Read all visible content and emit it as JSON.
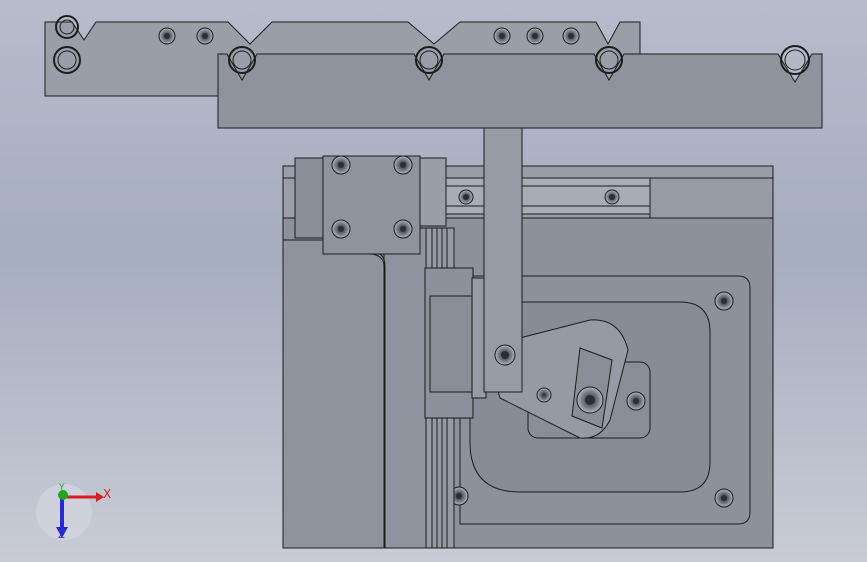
{
  "view": {
    "background_top": "#b7bccc",
    "background_bottom": "#c9ccd6",
    "part_fill": "#8f939e",
    "part_fill_dark": "#767a85",
    "part_fill_light": "#a3a7b2",
    "edge_color": "#1c1c1c"
  },
  "triad": {
    "x_label": "X",
    "y_label": "Y",
    "z_label": "Z",
    "x_color": "#d42020",
    "y_color": "#1fa81f",
    "z_color": "#2a2ad4"
  }
}
